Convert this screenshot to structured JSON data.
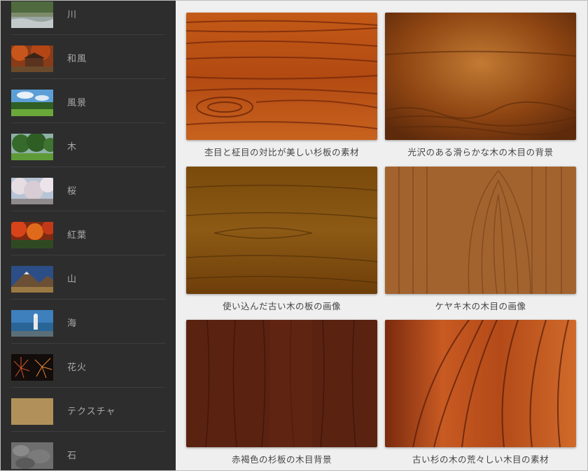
{
  "sidebar": {
    "items": [
      {
        "label": "川",
        "icon": "river-thumbnail"
      },
      {
        "label": "和風",
        "icon": "japanese-style-thumbnail"
      },
      {
        "label": "風景",
        "icon": "landscape-thumbnail"
      },
      {
        "label": "木",
        "icon": "tree-thumbnail"
      },
      {
        "label": "桜",
        "icon": "cherry-blossom-thumbnail"
      },
      {
        "label": "紅葉",
        "icon": "autumn-leaves-thumbnail"
      },
      {
        "label": "山",
        "icon": "mountain-thumbnail"
      },
      {
        "label": "海",
        "icon": "sea-thumbnail"
      },
      {
        "label": "花火",
        "icon": "fireworks-thumbnail"
      },
      {
        "label": "テクスチャ",
        "icon": "texture-thumbnail"
      },
      {
        "label": "石",
        "icon": "stone-thumbnail"
      }
    ]
  },
  "gallery": {
    "items": [
      {
        "caption": "杢目と柾目の対比が美しい杉板の素材",
        "color": "#b04c10"
      },
      {
        "caption": "光沢のある滑らかな木の木目の背景",
        "color": "#8e4512"
      },
      {
        "caption": "使い込んだ古い木の板の画像",
        "color": "#84520f"
      },
      {
        "caption": "ケヤキ木の木目の画像",
        "color": "#a0602e"
      },
      {
        "caption": "赤褐色の杉板の木目背景",
        "color": "#5a2211"
      },
      {
        "caption": "古い杉の木の荒々しい木目の素材",
        "color": "#b3501d"
      }
    ]
  }
}
